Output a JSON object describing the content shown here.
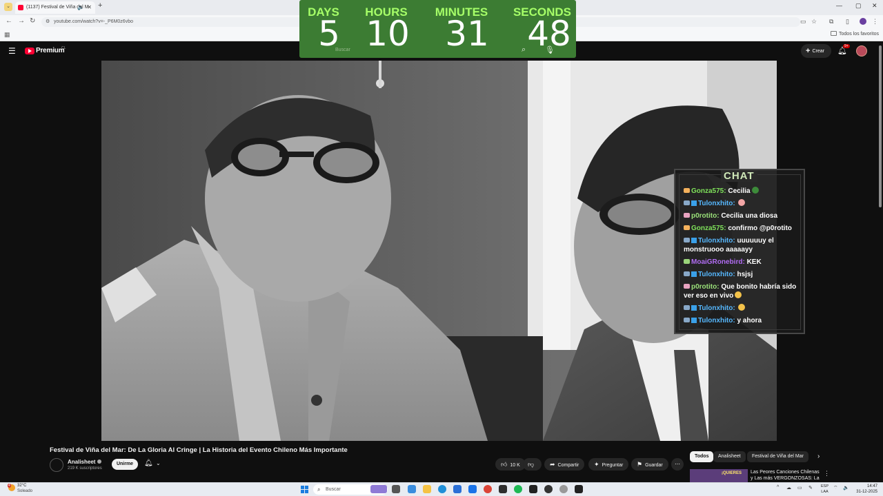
{
  "browser": {
    "tab_title": "(1137) Festival de Viña del M",
    "new_tab": "+",
    "url": "youtube.com/watch?v=-_P6M0z6vbo",
    "bookmarks_all": "Todos los favoritos",
    "window_controls": [
      "—",
      "▢",
      "✕"
    ]
  },
  "youtube": {
    "brand": "Premium",
    "country": "CL",
    "search_placeholder": "Buscar",
    "create_label": "Crear",
    "notif_count": "9+"
  },
  "countdown": {
    "labels": [
      "DAYS",
      "HOURS",
      "MINUTES",
      "SECONDS"
    ],
    "values": [
      "5",
      "10",
      "31",
      "48"
    ]
  },
  "chat": {
    "title": "CHAT",
    "messages": [
      {
        "user": "Gonza575",
        "text": "Cecilia",
        "user_color": "#7fe25a",
        "badge": "#f4b15c",
        "emote": "#3d8b3a"
      },
      {
        "user": "Tulonxhito",
        "text": "",
        "user_color": "#56b8ff",
        "badge": "#88a8c8",
        "emote": "#f3a6a6"
      },
      {
        "user": "p0rotito",
        "text": "Cecilia una diosa",
        "user_color": "#9be27a",
        "badge": "#e8a3c0",
        "emote": ""
      },
      {
        "user": "Gonza575",
        "text": "confirmo @p0rotito",
        "user_color": "#7fe25a",
        "badge": "#f4b15c",
        "emote": ""
      },
      {
        "user": "Tulonxhito",
        "text": "uuuuuuy el monstruooo aaaaayy",
        "user_color": "#56b8ff",
        "badge": "#88a8c8",
        "emote": ""
      },
      {
        "user": "MoaiGRonebird",
        "text": "KEK",
        "user_color": "#b06cf2",
        "badge": "#9ad47a",
        "emote": ""
      },
      {
        "user": "Tulonxhito",
        "text": "hsjsj",
        "user_color": "#56b8ff",
        "badge": "#88a8c8",
        "emote": ""
      },
      {
        "user": "p0rotito",
        "text": "Que bonito habría sido ver eso en vivo",
        "user_color": "#9be27a",
        "badge": "#e8a3c0",
        "emote": "#f3c24a"
      },
      {
        "user": "Tulonxhito",
        "text": "",
        "user_color": "#56b8ff",
        "badge": "#88a8c8",
        "emote": "#f3c24a"
      },
      {
        "user": "Tulonxhito",
        "text": "y ahora",
        "user_color": "#56b8ff",
        "badge": "#88a8c8",
        "emote": ""
      }
    ]
  },
  "video": {
    "title": "Festival de Viña del Mar: De La Gloria Al Cringe | La Historia del Evento Chileno Más Importante",
    "channel_name": "Analisheet",
    "subscribers": "219 K suscriptores",
    "join_label": "Unirme",
    "likes": "10 K",
    "share_label": "Compartir",
    "ask_label": "Preguntar",
    "save_label": "Guardar"
  },
  "related": {
    "chips": [
      "Todos",
      "Analisheet",
      "Festival de Viña del Mar"
    ],
    "item_title": "Las Peores Canciones Chilenas y Las más VERGONZOSAS: La",
    "item_thumb_text": "¡QUIERES"
  },
  "taskbar": {
    "temp": "32°C",
    "weather": "Soleado",
    "weather_badge": "4",
    "search": "Buscar",
    "lang_top": "ESP",
    "lang_bottom": "LAA",
    "time": "14:47",
    "date": "31-12-2025"
  }
}
